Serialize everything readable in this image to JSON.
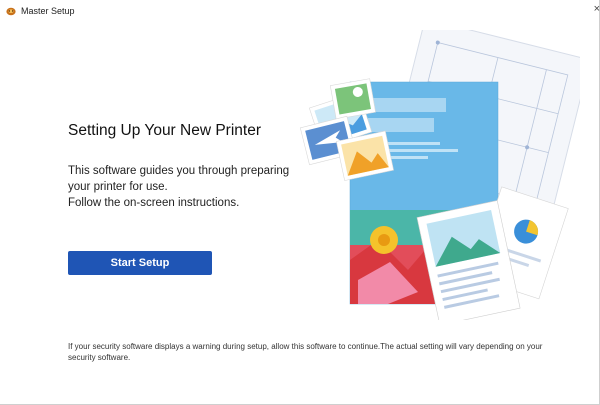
{
  "window": {
    "title": "Master Setup",
    "close_glyph": "×"
  },
  "icons": {
    "app": "app-logo-icon",
    "close": "close-icon"
  },
  "main": {
    "heading": "Setting Up Your New Printer",
    "description_lines": [
      "This software guides you through preparing",
      "your printer for use.",
      "Follow the on-screen instructions."
    ],
    "start_button_label": "Start Setup",
    "security_note": "If your security software displays a warning during setup, allow this software to continue.The actual setting will vary depending on your security software."
  },
  "colors": {
    "accent": "#1f55b5",
    "text": "#111111"
  }
}
